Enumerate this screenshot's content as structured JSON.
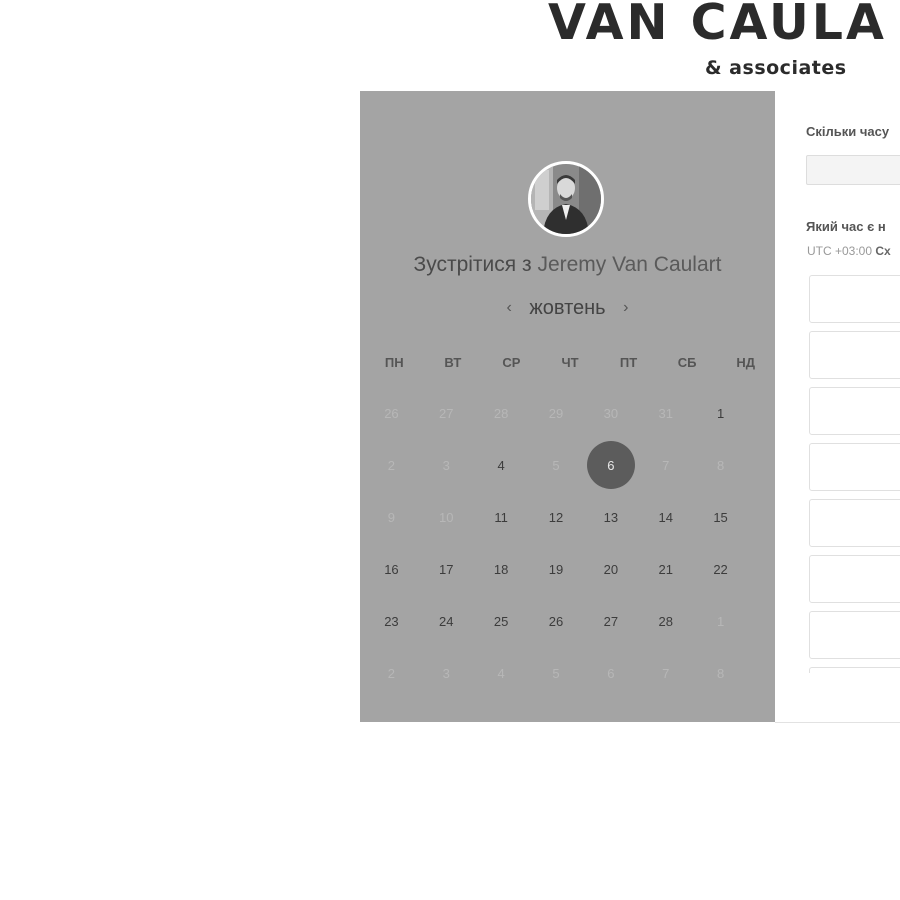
{
  "brand": {
    "title": "VAN CAULA",
    "subtitle": "& associates"
  },
  "calendar": {
    "meet_prefix": "Зустрітися з ",
    "host_name": "Jeremy Van Caulart",
    "month": "жовтень",
    "prev_icon": "chevron-left-icon",
    "next_icon": "chevron-right-icon",
    "weekdays": [
      "ПН",
      "ВТ",
      "СР",
      "ЧТ",
      "ПТ",
      "СБ",
      "НД"
    ],
    "selected_day": "6",
    "days": [
      {
        "d": "26",
        "m": true
      },
      {
        "d": "27",
        "m": true
      },
      {
        "d": "28",
        "m": true
      },
      {
        "d": "29",
        "m": true
      },
      {
        "d": "30",
        "m": true
      },
      {
        "d": "31",
        "m": true
      },
      {
        "d": "1",
        "m": false
      },
      {
        "d": "2",
        "m": true
      },
      {
        "d": "3",
        "m": true
      },
      {
        "d": "4",
        "m": false
      },
      {
        "d": "5",
        "m": true
      },
      {
        "d": "6",
        "m": false,
        "sel": true
      },
      {
        "d": "7",
        "m": true
      },
      {
        "d": "8",
        "m": true
      },
      {
        "d": "9",
        "m": true
      },
      {
        "d": "10",
        "m": true
      },
      {
        "d": "11",
        "m": false
      },
      {
        "d": "12",
        "m": false
      },
      {
        "d": "13",
        "m": false
      },
      {
        "d": "14",
        "m": false
      },
      {
        "d": "15",
        "m": false
      },
      {
        "d": "16",
        "m": false
      },
      {
        "d": "17",
        "m": false
      },
      {
        "d": "18",
        "m": false
      },
      {
        "d": "19",
        "m": false
      },
      {
        "d": "20",
        "m": false
      },
      {
        "d": "21",
        "m": false
      },
      {
        "d": "22",
        "m": false
      },
      {
        "d": "23",
        "m": false
      },
      {
        "d": "24",
        "m": false
      },
      {
        "d": "25",
        "m": false
      },
      {
        "d": "26",
        "m": false
      },
      {
        "d": "27",
        "m": false
      },
      {
        "d": "28",
        "m": false
      },
      {
        "d": "1",
        "m": true
      },
      {
        "d": "2",
        "m": true
      },
      {
        "d": "3",
        "m": true
      },
      {
        "d": "4",
        "m": true
      },
      {
        "d": "5",
        "m": true
      },
      {
        "d": "6",
        "m": true
      },
      {
        "d": "7",
        "m": true
      },
      {
        "d": "8",
        "m": true
      }
    ],
    "colors": {
      "panel_bg": "#a4a4a4",
      "selected_bg": "#5c5c5c"
    }
  },
  "booking": {
    "duration_question": "Скільки часу",
    "duration_value": "",
    "time_question": "Який час є н",
    "timezone_offset": "UTC +03:00",
    "timezone_name": "Сх",
    "slot_count": 8
  }
}
